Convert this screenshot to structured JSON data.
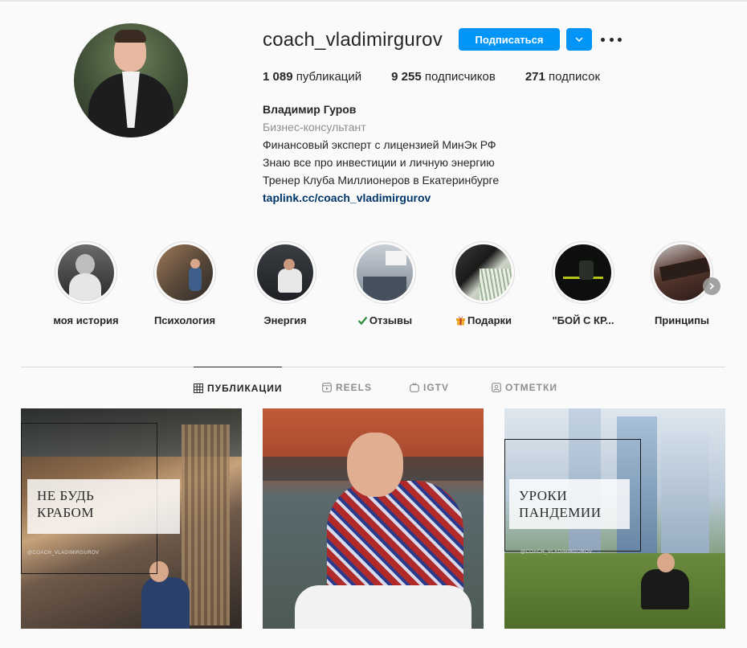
{
  "profile": {
    "username": "coach_vladimirgurov",
    "follow_label": "Подписаться",
    "stats": [
      {
        "num": "1 089",
        "label": "публикаций"
      },
      {
        "num": "9 255",
        "label": "подписчиков"
      },
      {
        "num": "271",
        "label": "подписок"
      }
    ],
    "bio": {
      "name": "Владимир Гуров",
      "category": "Бизнес-консультант",
      "lines": [
        "Финансовый эксперт с лицензией МинЭк РФ",
        "Знаю все про инвестиции и личную энергию",
        "Тренер Клуба Миллионеров в Екатеринбурге"
      ],
      "link": "taplink.cc/coach_vladimirgurov"
    }
  },
  "highlights": [
    {
      "label": "моя история"
    },
    {
      "label": "Психология"
    },
    {
      "label": "Энергия"
    },
    {
      "label": "Отзывы",
      "emoji": "check-mark-icon"
    },
    {
      "label": "Подарки",
      "emoji": "gift-icon"
    },
    {
      "label": "\"БОЙ С КР..."
    },
    {
      "label": "Принципы"
    }
  ],
  "tabs": [
    {
      "label": "ПУБЛИКАЦИИ",
      "icon": "grid-icon",
      "active": true
    },
    {
      "label": "REELS",
      "icon": "reels-icon"
    },
    {
      "label": "IGTV",
      "icon": "igtv-icon"
    },
    {
      "label": "ОТМЕТКИ",
      "icon": "tagged-icon"
    }
  ],
  "posts": [
    {
      "caption": [
        "НЕ БУДЬ",
        "КРАБОМ"
      ],
      "watermark": "@COACH_VLADIMIRGUROV"
    },
    {
      "caption": []
    },
    {
      "caption": [
        "УРОКИ",
        "ПАНДЕМИИ"
      ],
      "watermark": "@COACH_VLADIMIRGUROV"
    }
  ],
  "colors": {
    "accent": "#0095f6",
    "link": "#00376b",
    "muted": "#8e8e8e"
  }
}
